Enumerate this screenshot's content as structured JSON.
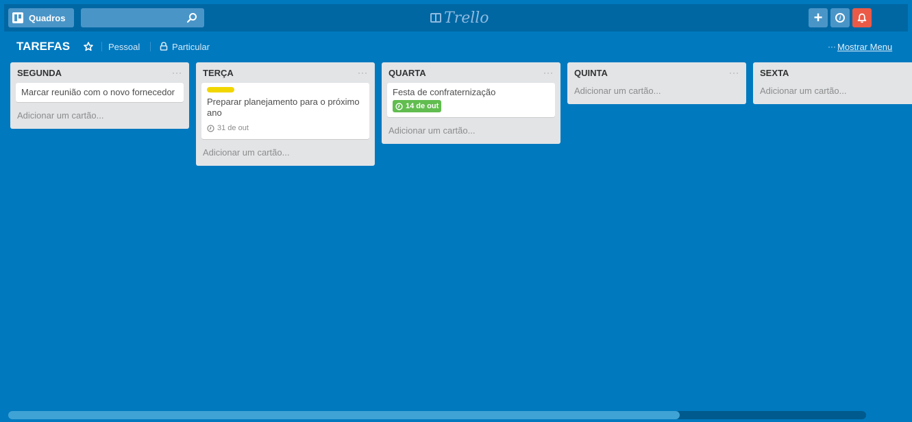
{
  "header": {
    "boards_label": "Quadros",
    "search_value": "",
    "logo_text": "Trello",
    "add_label": "+"
  },
  "board": {
    "title": "TAREFAS",
    "team": "Pessoal",
    "visibility": "Particular",
    "menu_dots": "···",
    "menu_label": "Mostrar Menu"
  },
  "lists": [
    {
      "title": "SEGUNDA",
      "menu": "···",
      "cards": [
        {
          "text": "Marcar reunião com o novo fornecedor"
        }
      ],
      "add_card": "Adicionar um cartão..."
    },
    {
      "title": "TERÇA",
      "menu": "···",
      "cards": [
        {
          "text": "Preparar planejamento para o próximo ano",
          "label_color": "#f2d600",
          "due": "31 de out"
        }
      ],
      "add_card": "Adicionar um cartão..."
    },
    {
      "title": "QUARTA",
      "menu": "···",
      "cards": [
        {
          "text": "Festa de confraternização",
          "due": "14 de out",
          "due_color": "#61bd4f"
        }
      ],
      "add_card": "Adicionar um cartão..."
    },
    {
      "title": "QUINTA",
      "menu": "···",
      "cards": [],
      "add_card": "Adicionar um cartão..."
    },
    {
      "title": "SEXTA",
      "menu": "···",
      "cards": [],
      "add_card": "Adicionar um cartão..."
    }
  ],
  "colors": {
    "board_bg": "#0079bf",
    "header_bg": "#0067a3",
    "notification": "#eb5a46",
    "label_yellow": "#f2d600",
    "due_green": "#61bd4f"
  },
  "icons": {
    "boards": "boards-icon",
    "search": "search-icon",
    "add": "plus-icon",
    "info": "info-icon",
    "notifications": "bell-icon",
    "star": "star-icon",
    "lock": "lock-icon",
    "clock": "clock-icon"
  }
}
